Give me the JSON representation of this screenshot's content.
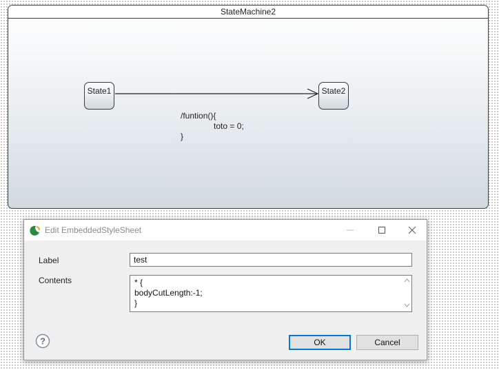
{
  "diagram": {
    "machine_title": "StateMachine2",
    "states": [
      {
        "label": "State1"
      },
      {
        "label": "State2"
      }
    ],
    "transition_effect": [
      "/funtion(){",
      "toto = 0;",
      "}"
    ]
  },
  "dialog": {
    "title": "Edit EmbeddedStyleSheet",
    "label_field": {
      "label": "Label",
      "value": "test"
    },
    "contents_field": {
      "label": "Contents",
      "lines": [
        "* {",
        "bodyCutLength:-1;",
        "}"
      ]
    },
    "buttons": {
      "ok": "OK",
      "cancel": "Cancel"
    },
    "icons": {
      "app": "eclipse-icon",
      "help": "help-icon",
      "minimize": "minimize-icon",
      "maximize": "maximize-icon",
      "close": "close-icon"
    }
  },
  "colors": {
    "accent": "#0078d7",
    "frame": "#3a3a3a",
    "dialog_bg": "#f0f0f0"
  }
}
